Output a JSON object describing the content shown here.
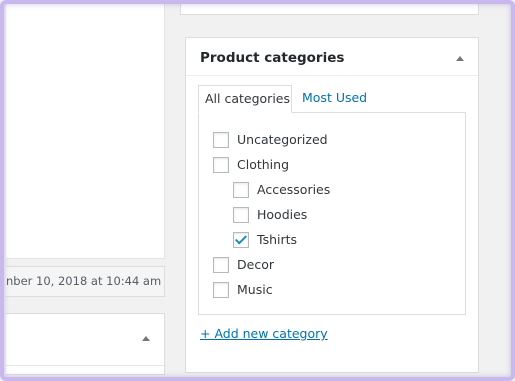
{
  "left": {
    "timestamp": "nber 10, 2018 at 10:44 am"
  },
  "product_categories": {
    "title": "Product categories",
    "tabs": [
      {
        "label": "All categories",
        "active": true
      },
      {
        "label": "Most Used",
        "active": false
      }
    ],
    "items": [
      {
        "label": "Uncategorized",
        "checked": false,
        "level": 0
      },
      {
        "label": "Clothing",
        "checked": false,
        "level": 0
      },
      {
        "label": "Accessories",
        "checked": false,
        "level": 1
      },
      {
        "label": "Hoodies",
        "checked": false,
        "level": 1
      },
      {
        "label": "Tshirts",
        "checked": true,
        "level": 1
      },
      {
        "label": "Decor",
        "checked": false,
        "level": 0
      },
      {
        "label": "Music",
        "checked": false,
        "level": 0
      }
    ],
    "add_link": "+ Add new category"
  },
  "colors": {
    "link": "#0073aa",
    "check": "#1e8cbe",
    "frame_glow": "#c9b8ee"
  },
  "icons": {
    "collapse": "triangle-up-icon",
    "checked": "checkmark-icon"
  }
}
